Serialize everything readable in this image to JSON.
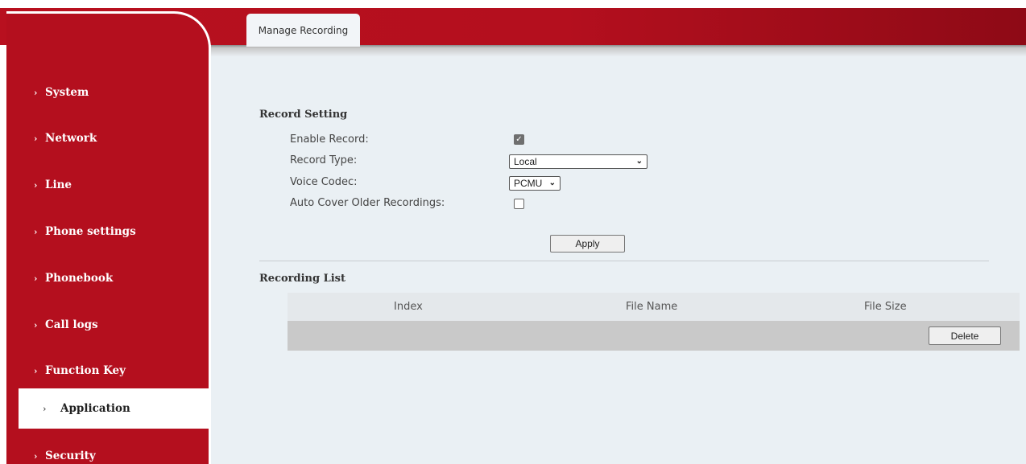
{
  "header": {
    "tab_label": "Manage Recording"
  },
  "sidebar": {
    "items": [
      {
        "label": "System",
        "active": false
      },
      {
        "label": "Network",
        "active": false
      },
      {
        "label": "Line",
        "active": false
      },
      {
        "label": "Phone settings",
        "active": false
      },
      {
        "label": "Phonebook",
        "active": false
      },
      {
        "label": "Call logs",
        "active": false
      },
      {
        "label": "Function Key",
        "active": false
      },
      {
        "label": "Application",
        "active": true
      },
      {
        "label": "Security",
        "active": false
      }
    ],
    "arrow_glyph": "›"
  },
  "record_setting": {
    "title": "Record Setting",
    "enable_record_label": "Enable Record:",
    "enable_record_checked": true,
    "record_type_label": "Record Type:",
    "record_type_value": "Local",
    "voice_codec_label": "Voice Codec:",
    "voice_codec_value": "PCMU",
    "auto_cover_label": "Auto Cover Older Recordings:",
    "auto_cover_checked": false,
    "apply_label": "Apply"
  },
  "recording_list": {
    "title": "Recording List",
    "columns": [
      "Index",
      "File Name",
      "File Size"
    ],
    "delete_label": "Delete"
  },
  "colors": {
    "brand_red": "#b40f1e",
    "content_bg": "#eaf0f4"
  }
}
